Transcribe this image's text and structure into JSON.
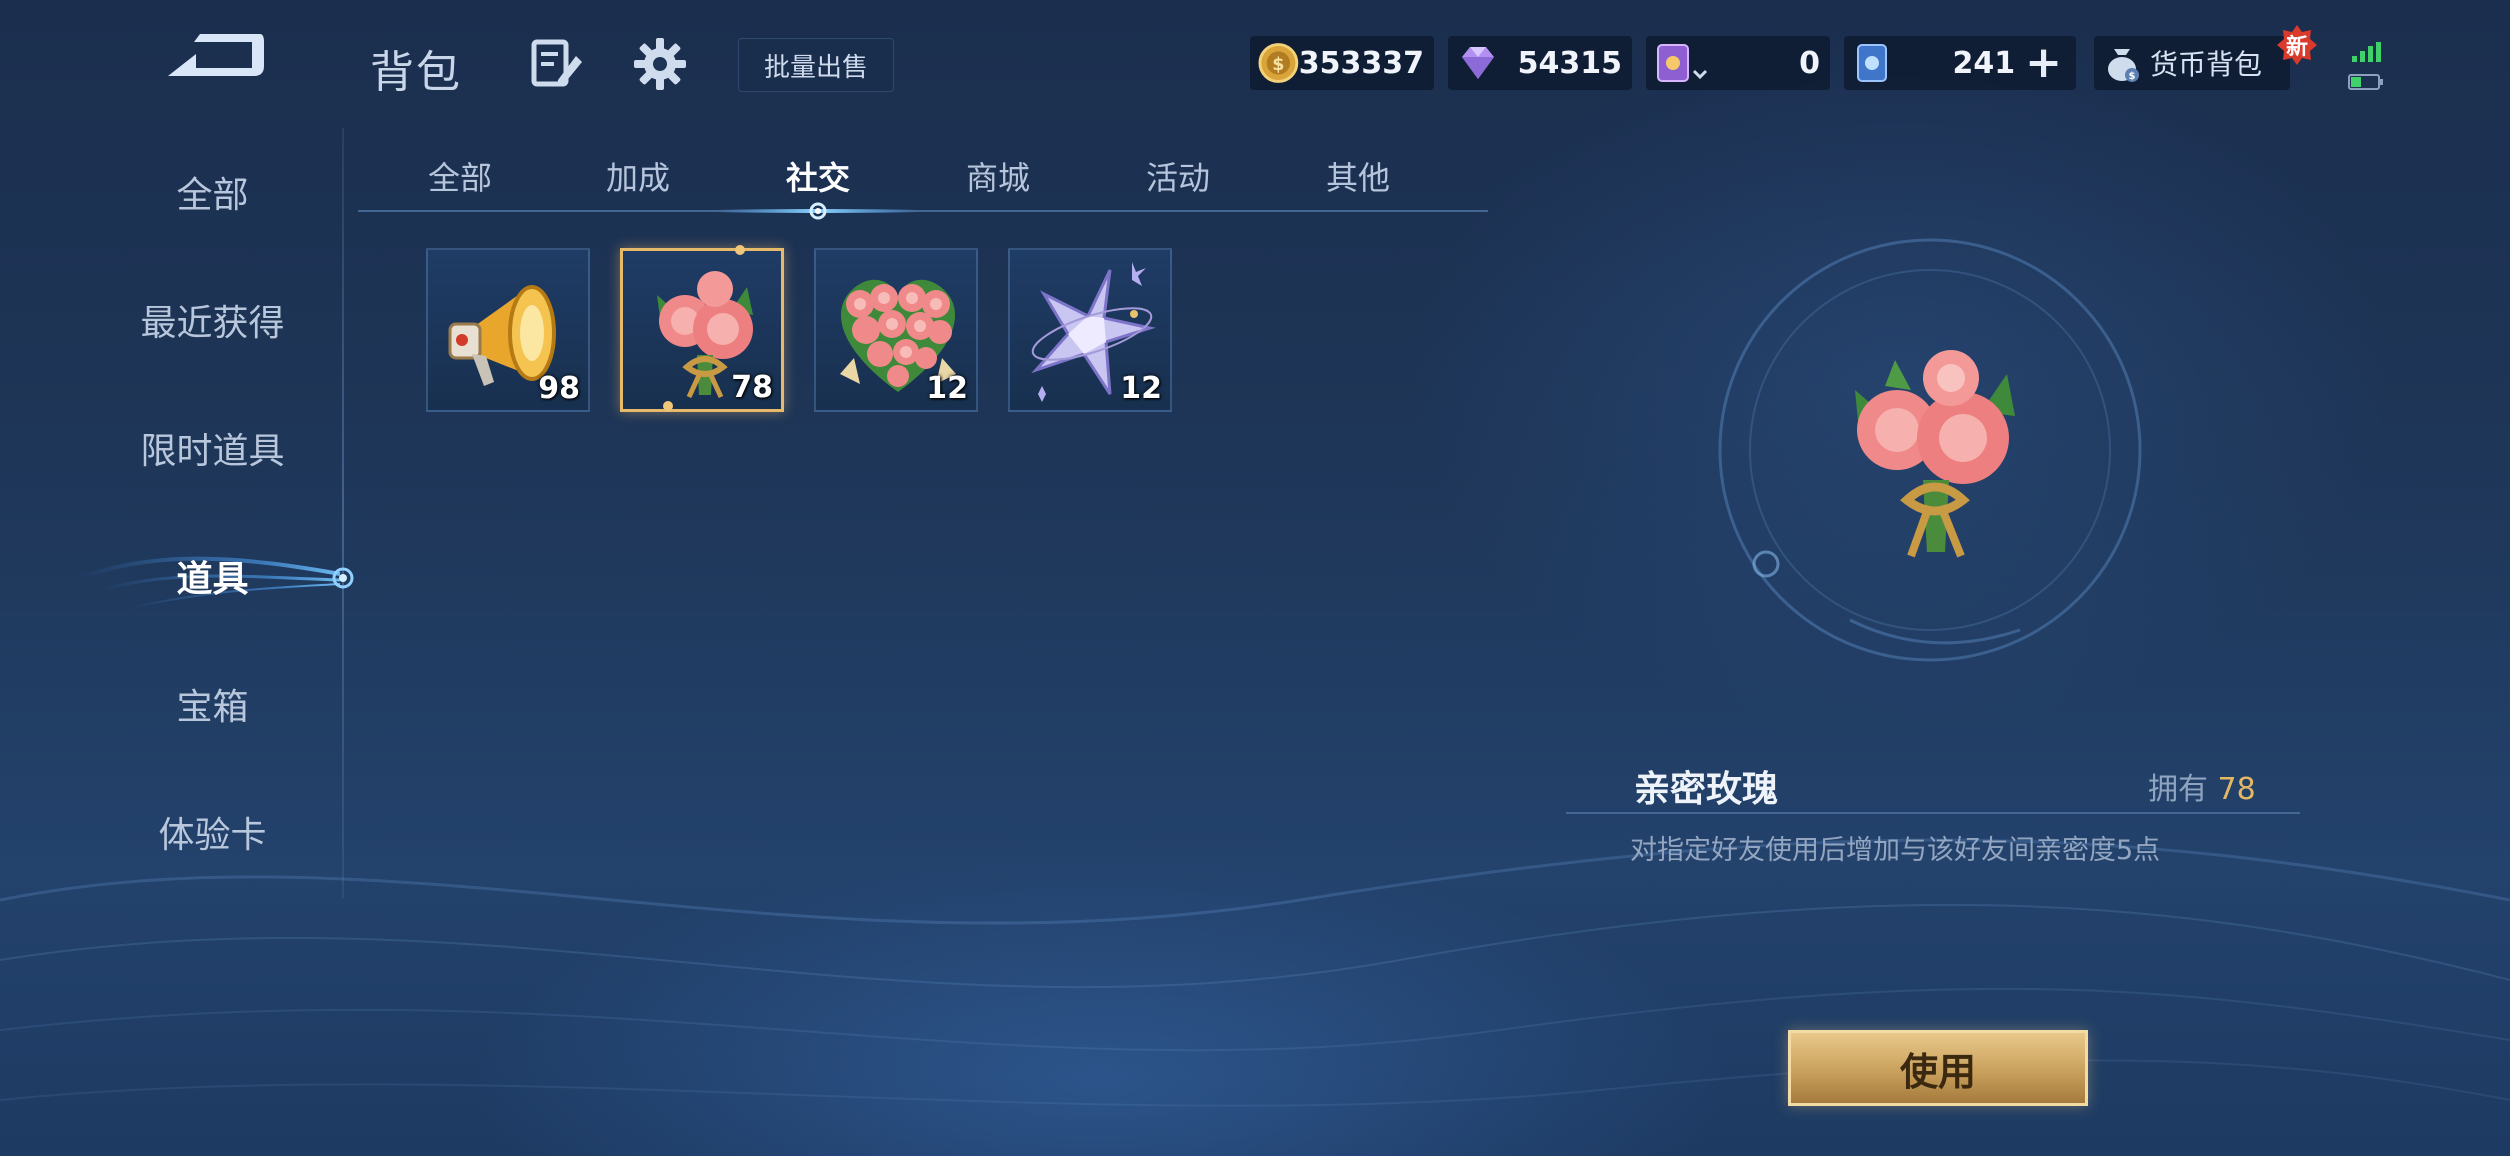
{
  "header": {
    "title": "背包",
    "bulk_sell_label": "批量出售"
  },
  "currencies": {
    "gold": "353337",
    "diamond": "54315",
    "ticket": "0",
    "coupon": "241",
    "wallet_label": "货币背包",
    "new_badge": "新"
  },
  "sidebar": {
    "items": [
      {
        "label": "全部"
      },
      {
        "label": "最近获得"
      },
      {
        "label": "限时道具"
      },
      {
        "label": "道具",
        "active": true
      },
      {
        "label": "宝箱"
      },
      {
        "label": "体验卡"
      }
    ]
  },
  "tabs": [
    {
      "label": "全部"
    },
    {
      "label": "加成"
    },
    {
      "label": "社交",
      "active": true
    },
    {
      "label": "商城"
    },
    {
      "label": "活动"
    },
    {
      "label": "其他"
    }
  ],
  "items": [
    {
      "icon": "megaphone-icon",
      "count": "98"
    },
    {
      "icon": "rose-bouquet-icon",
      "count": "78",
      "selected": true
    },
    {
      "icon": "rose-heart-bouquet-icon",
      "count": "12"
    },
    {
      "icon": "crystal-star-icon",
      "count": "12"
    }
  ],
  "detail": {
    "name": "亲密玫瑰",
    "owned_label": "拥有",
    "owned_count": "78",
    "description": "对指定好友使用后增加与该好友间亲密度5点",
    "use_label": "使用"
  },
  "colors": {
    "accent_gold": "#e3b763",
    "background": "#1e3658",
    "tab_active": "#ffffff"
  }
}
